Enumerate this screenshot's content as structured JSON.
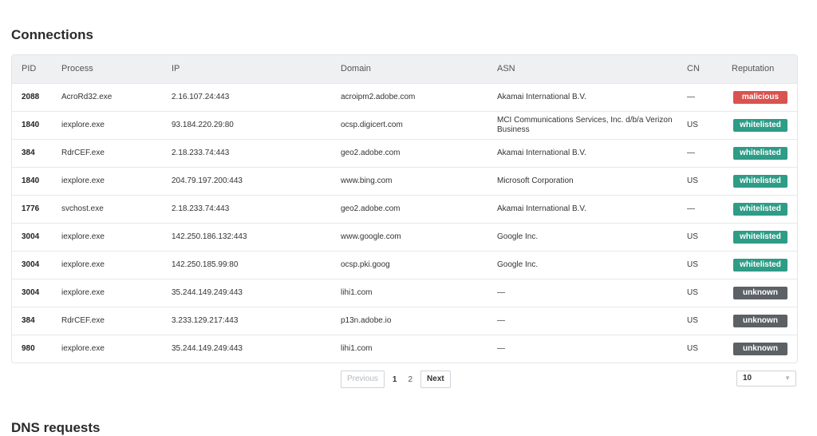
{
  "connections": {
    "title": "Connections",
    "columns": {
      "pid": "PID",
      "process": "Process",
      "ip": "IP",
      "domain": "Domain",
      "asn": "ASN",
      "cn": "CN",
      "reputation": "Reputation"
    },
    "rows": [
      {
        "pid": "2088",
        "process": "AcroRd32.exe",
        "ip": "2.16.107.24:443",
        "domain": "acroipm2.adobe.com",
        "asn": "Akamai International B.V.",
        "cn": "—",
        "reputation": "malicious"
      },
      {
        "pid": "1840",
        "process": "iexplore.exe",
        "ip": "93.184.220.29:80",
        "domain": "ocsp.digicert.com",
        "asn": "MCI Communications Services, Inc. d/b/a Verizon Business",
        "cn": "US",
        "reputation": "whitelisted"
      },
      {
        "pid": "384",
        "process": "RdrCEF.exe",
        "ip": "2.18.233.74:443",
        "domain": "geo2.adobe.com",
        "asn": "Akamai International B.V.",
        "cn": "—",
        "reputation": "whitelisted"
      },
      {
        "pid": "1840",
        "process": "iexplore.exe",
        "ip": "204.79.197.200:443",
        "domain": "www.bing.com",
        "asn": "Microsoft Corporation",
        "cn": "US",
        "reputation": "whitelisted"
      },
      {
        "pid": "1776",
        "process": "svchost.exe",
        "ip": "2.18.233.74:443",
        "domain": "geo2.adobe.com",
        "asn": "Akamai International B.V.",
        "cn": "—",
        "reputation": "whitelisted"
      },
      {
        "pid": "3004",
        "process": "iexplore.exe",
        "ip": "142.250.186.132:443",
        "domain": "www.google.com",
        "asn": "Google Inc.",
        "cn": "US",
        "reputation": "whitelisted"
      },
      {
        "pid": "3004",
        "process": "iexplore.exe",
        "ip": "142.250.185.99:80",
        "domain": "ocsp.pki.goog",
        "asn": "Google Inc.",
        "cn": "US",
        "reputation": "whitelisted"
      },
      {
        "pid": "3004",
        "process": "iexplore.exe",
        "ip": "35.244.149.249:443",
        "domain": "lihi1.com",
        "asn": "—",
        "cn": "US",
        "reputation": "unknown"
      },
      {
        "pid": "384",
        "process": "RdrCEF.exe",
        "ip": "3.233.129.217:443",
        "domain": "p13n.adobe.io",
        "asn": "—",
        "cn": "US",
        "reputation": "unknown"
      },
      {
        "pid": "980",
        "process": "iexplore.exe",
        "ip": "35.244.149.249:443",
        "domain": "lihi1.com",
        "asn": "—",
        "cn": "US",
        "reputation": "unknown"
      }
    ],
    "reputation_colors": {
      "malicious": "#d9534f",
      "whitelisted": "#2e9c86",
      "unknown": "#5c6166"
    },
    "pagination": {
      "previous": "Previous",
      "pages": [
        "1",
        "2"
      ],
      "current": "1",
      "next": "Next"
    },
    "per_page": {
      "value": "10",
      "icon": "chevron-down-icon"
    }
  },
  "dns": {
    "title": "DNS requests"
  }
}
